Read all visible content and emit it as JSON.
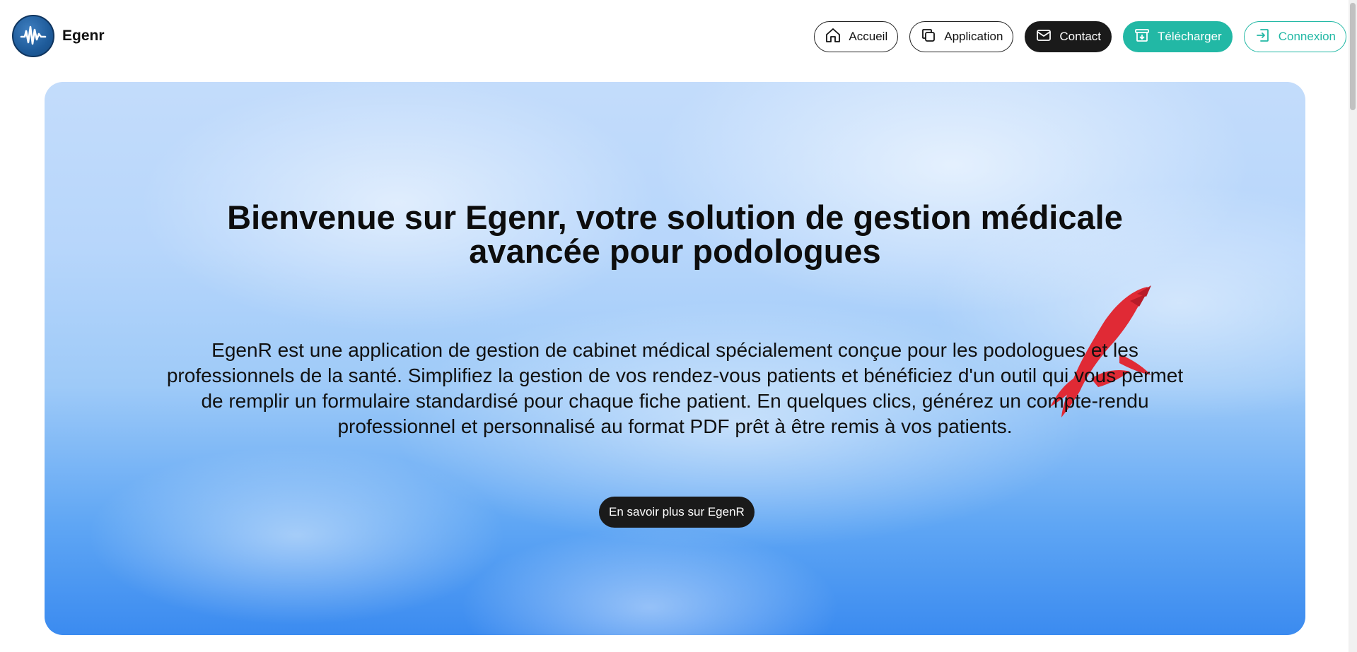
{
  "brand": {
    "name": "Egenr",
    "logo_icon": "waveform-icon"
  },
  "nav": {
    "items": [
      {
        "label": "Accueil",
        "icon": "home-icon",
        "style": "outline"
      },
      {
        "label": "Application",
        "icon": "copy-icon",
        "style": "outline"
      },
      {
        "label": "Contact",
        "icon": "mail-icon",
        "style": "dark"
      },
      {
        "label": "Télécharger",
        "icon": "archive-download-icon",
        "style": "teal"
      },
      {
        "label": "Connexion",
        "icon": "login-icon",
        "style": "outline-teal"
      }
    ]
  },
  "hero": {
    "title": "Bienvenue sur Egenr, votre solution de gestion médicale avancée pour podologues",
    "description": "EgenR est une application de gestion de cabinet médical spécialement conçue pour les podologues et les professionnels de la santé. Simplifiez la gestion de vos rendez-vous patients et bénéficiez d'un outil qui vous permet de remplir un formulaire standardisé pour chaque fiche patient. En quelques clics, générez un compte-rendu professionnel et personnalisé au format PDF prêt à être remis à vos patients.",
    "cta_label": "En savoir plus sur EgenR"
  },
  "colors": {
    "teal": "#22b8a5",
    "dark": "#1a1a1a",
    "logo_blue": "#1e5b9a",
    "sky_top": "#c3dcfb",
    "sky_bottom": "#3b8bf0",
    "bird_red": "#e02a35"
  }
}
